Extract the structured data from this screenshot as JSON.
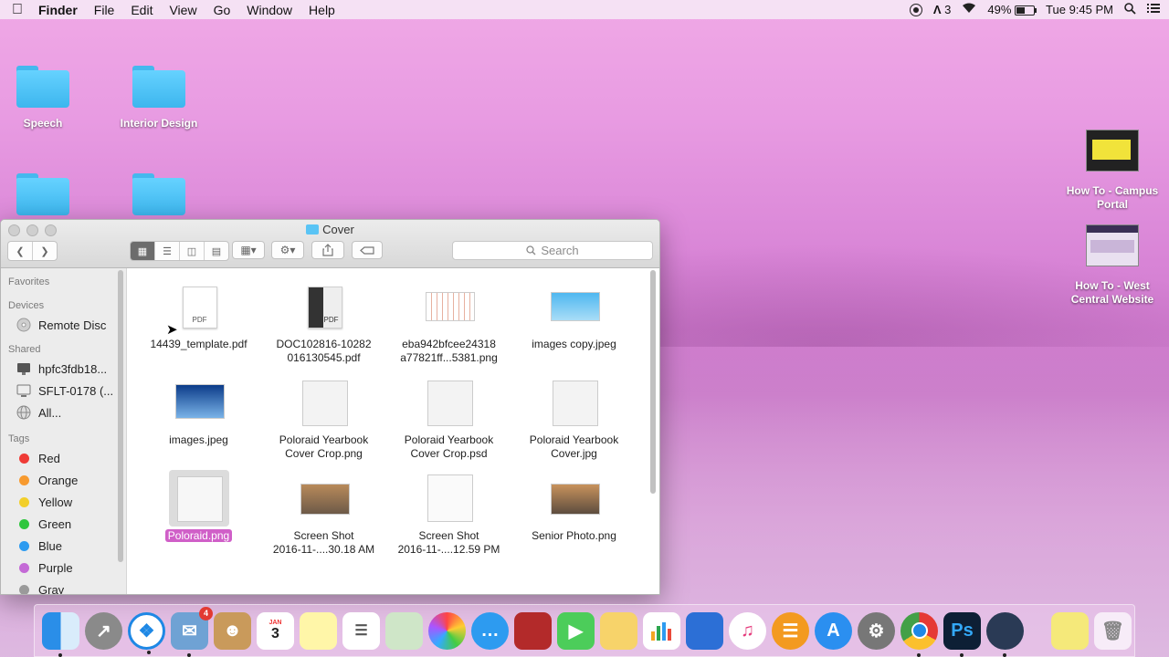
{
  "menubar": {
    "app": "Finder",
    "items": [
      "File",
      "Edit",
      "View",
      "Go",
      "Window",
      "Help"
    ],
    "status_count": "3",
    "battery": "49%",
    "clock": "Tue 9:45 PM"
  },
  "desktop": {
    "items": [
      {
        "label": "Speech"
      },
      {
        "label": "Interior Design"
      },
      {
        "label": "How To - Campus Portal"
      },
      {
        "label": "How To - West Central Website"
      }
    ]
  },
  "window": {
    "title": "Cover",
    "search_placeholder": "Search"
  },
  "sidebar": {
    "favorites_header": "Favorites",
    "devices_header": "Devices",
    "devices": [
      "Remote Disc"
    ],
    "shared_header": "Shared",
    "shared": [
      "hpfc3fdb18...",
      "SFLT-0178 (...",
      "All..."
    ],
    "tags_header": "Tags",
    "tags": [
      {
        "label": "Red",
        "color": "#ef3b36"
      },
      {
        "label": "Orange",
        "color": "#f79a2f"
      },
      {
        "label": "Yellow",
        "color": "#f2cf2a"
      },
      {
        "label": "Green",
        "color": "#2fc63e"
      },
      {
        "label": "Blue",
        "color": "#2d9bf0"
      },
      {
        "label": "Purple",
        "color": "#c46ad6"
      },
      {
        "label": "Gray",
        "color": "#9a9a9a"
      }
    ]
  },
  "files": [
    {
      "line1": "14439_template.pdf",
      "line2": ""
    },
    {
      "line1": "DOC102816-10282",
      "line2": "016130545.pdf"
    },
    {
      "line1": "eba942bfcee24318",
      "line2": "a77821ff...5381.png"
    },
    {
      "line1": "images copy.jpeg",
      "line2": ""
    },
    {
      "line1": "images.jpeg",
      "line2": ""
    },
    {
      "line1": "Poloraid Yearbook",
      "line2": "Cover Crop.png"
    },
    {
      "line1": "Poloraid Yearbook",
      "line2": "Cover Crop.psd"
    },
    {
      "line1": "Poloraid Yearbook",
      "line2": "Cover.jpg"
    },
    {
      "line1": "Poloraid.png",
      "line2": ""
    },
    {
      "line1": "Screen Shot",
      "line2": "2016-11-....30.18 AM"
    },
    {
      "line1": "Screen Shot",
      "line2": "2016-11-....12.59 PM"
    },
    {
      "line1": "Senior Photo.png",
      "line2": ""
    }
  ],
  "dock": {
    "mail_badge": "4",
    "calendar_month": "JAN",
    "calendar_day": "3"
  }
}
